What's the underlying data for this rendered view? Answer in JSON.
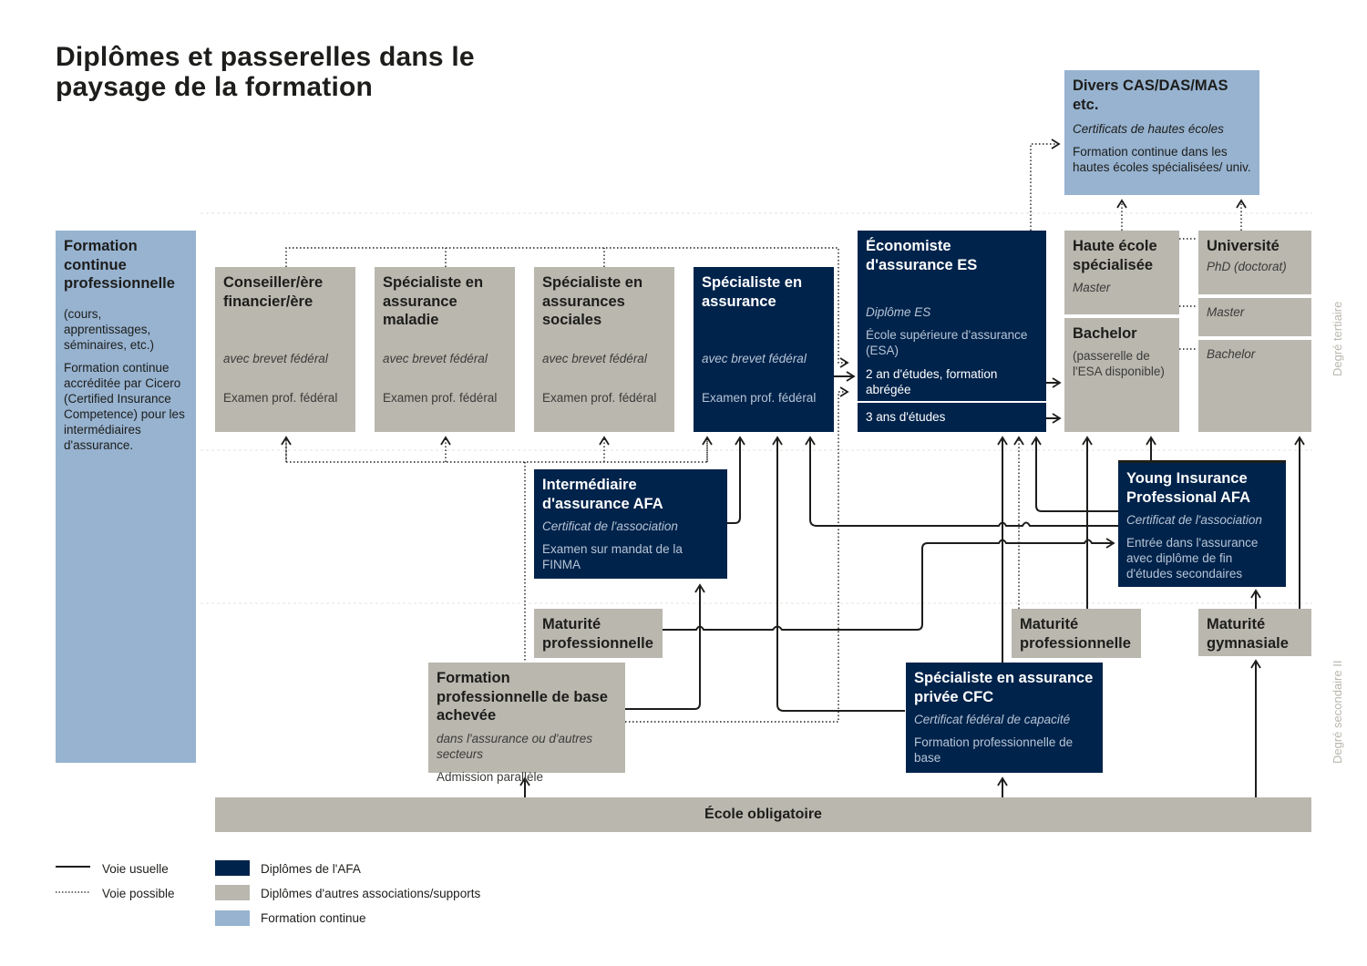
{
  "title": "Diplômes et passerelles dans le paysage de la formation",
  "colors": {
    "afa": "#00234b",
    "other": "#b9b7ae",
    "continuing": "#97b3d0",
    "lines": "#1d1d1b",
    "zone_label": "#b9b7ae"
  },
  "zones": {
    "tertiary": "Degré tertiaire",
    "secondary": "Degré secondaire II"
  },
  "boxes": {
    "divers": {
      "title": "Divers CAS/DAS/MAS etc.",
      "subtitle": "Certificats de hautes écoles",
      "text": "Formation continue dans les hautes écoles spécialisées/ univ."
    },
    "formation_continue": {
      "title": "Formation continue professionnelle",
      "text1": "(cours, apprentissages, séminaires, etc.)",
      "text2": "Formation continue accréditée par Cicero (Certified Insurance Competence) pour les intermédiaires d'assurance."
    },
    "conseiller": {
      "title": "Conseiller/ère financier/ère",
      "subtitle": "avec brevet fédéral",
      "text": "Examen prof. fédéral"
    },
    "maladie": {
      "title": "Spécialiste en assurance maladie",
      "subtitle": "avec brevet fédéral",
      "text": "Examen prof. fédéral"
    },
    "sociales": {
      "title": "Spécialiste en assurances sociales",
      "subtitle": "avec brevet fédéral",
      "text": "Examen prof. fédéral"
    },
    "specialiste": {
      "title": "Spécialiste en assurance",
      "subtitle": "avec brevet fédéral",
      "text": "Examen prof. fédéral"
    },
    "economiste": {
      "title": "Économiste d'assurance ES",
      "subtitle": "Diplôme ES",
      "text": "École supérieure d'assurance (ESA)",
      "option1": "2 an d'études, formation abrégée",
      "option2": "3 ans d'études"
    },
    "hes": {
      "title": "Haute école spécialisée",
      "subtitle": "Master"
    },
    "hes_bachelor": {
      "title": "Bachelor",
      "text": "(passerelle de l'ESA disponible)"
    },
    "universite": {
      "title": "Université",
      "subtitle": "PhD (doctorat)",
      "master": "Master",
      "bachelor": "Bachelor"
    },
    "intermediaire": {
      "title": "Intermédiaire d'assurance AFA",
      "subtitle": "Certificat de l'association",
      "text": "Examen sur mandat de la FINMA"
    },
    "young": {
      "title": "Young Insurance Professional AFA",
      "subtitle": "Certificat de l'association",
      "text": "Entrée dans l'assurance avec diplôme de fin d'études secondaires"
    },
    "maturite_pro_left": {
      "title": "Maturité professionnelle"
    },
    "maturite_pro_right": {
      "title": "Maturité professionnelle"
    },
    "maturite_gym": {
      "title": "Maturité gymnasiale"
    },
    "formation_base": {
      "title": "Formation professionnelle de base achevée",
      "subtitle": "dans l'assurance ou d'autres secteurs",
      "text": "Admission parallèle"
    },
    "cfc": {
      "title": "Spécialiste en assurance privée CFC",
      "subtitle": "Certificat fédéral de capacité",
      "text": "Formation professionnelle de base"
    },
    "ecole": {
      "title": "École obligatoire"
    }
  },
  "legend": {
    "usual": "Voie usuelle",
    "possible": "Voie possible",
    "afa": "Diplômes de l'AFA",
    "other": "Diplômes d'autres associations/supports",
    "continuing": "Formation continue"
  }
}
